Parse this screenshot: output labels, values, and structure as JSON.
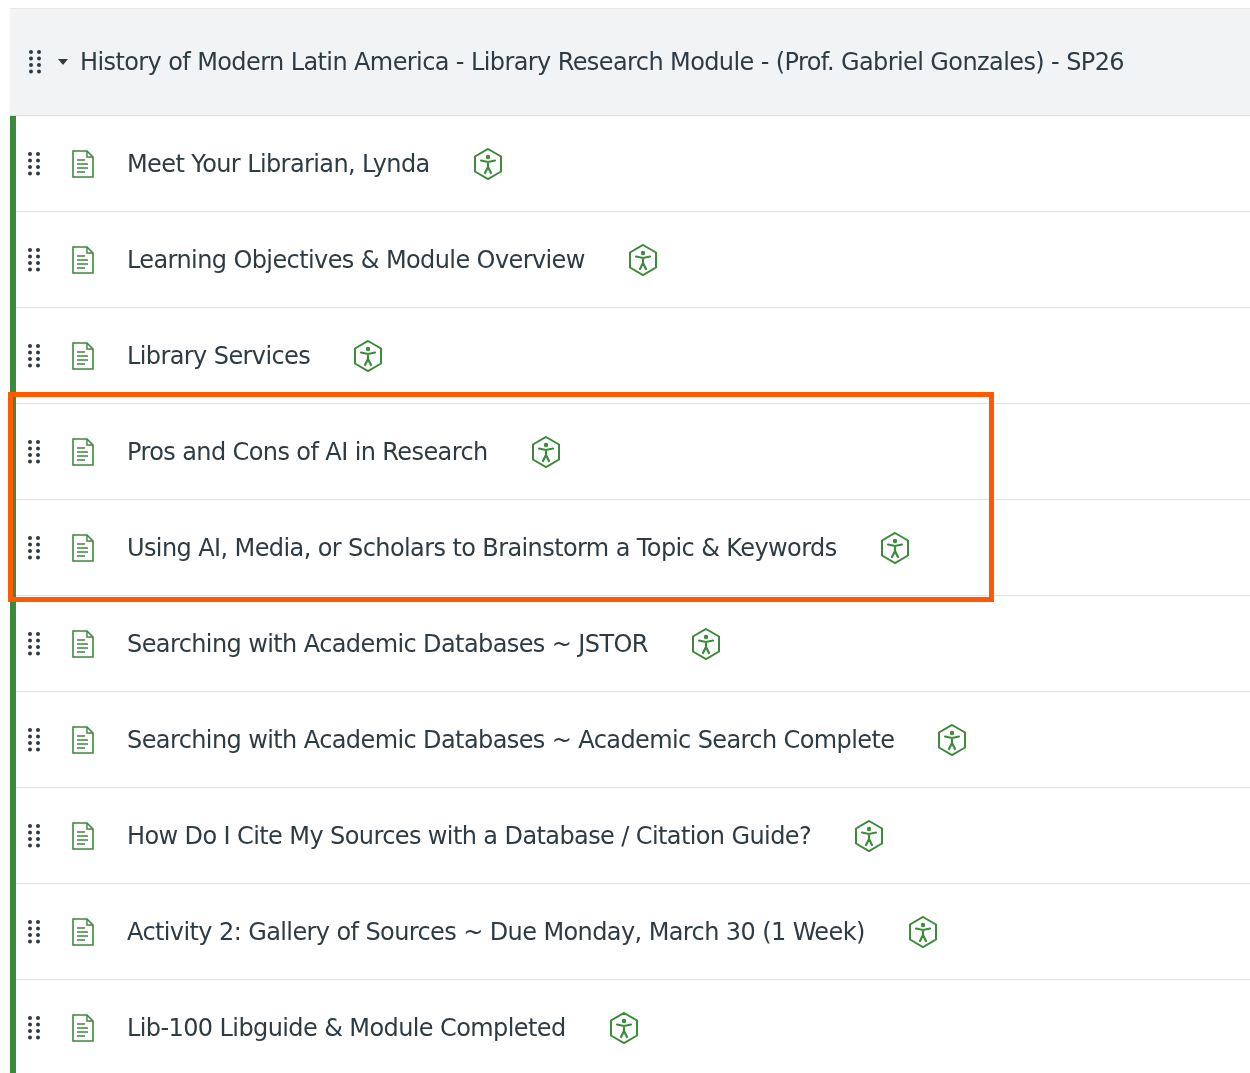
{
  "module": {
    "title": "History of Modern Latin America - Library Research Module - (Prof. Gabriel Gonzales) - SP26",
    "expanded": true
  },
  "items": [
    {
      "title": "Meet Your Librarian, Lynda",
      "highlighted": false
    },
    {
      "title": "Learning Objectives & Module Overview",
      "highlighted": false
    },
    {
      "title": "Library Services",
      "highlighted": false
    },
    {
      "title": "Pros and Cons of AI in Research",
      "highlighted": true
    },
    {
      "title": "Using AI, Media, or Scholars to Brainstorm a Topic & Keywords",
      "highlighted": true
    },
    {
      "title": "Searching with Academic Databases ~ JSTOR",
      "highlighted": false
    },
    {
      "title": "Searching with Academic Databases ~ Academic Search Complete",
      "highlighted": false
    },
    {
      "title": "How Do I Cite My Sources with a Database / Citation Guide?",
      "highlighted": false
    },
    {
      "title": "Activity 2: Gallery of Sources ~ Due Monday, March 30 (1 Week)",
      "highlighted": false
    },
    {
      "title": "Lib-100 Libguide & Module Completed",
      "highlighted": false
    }
  ]
}
